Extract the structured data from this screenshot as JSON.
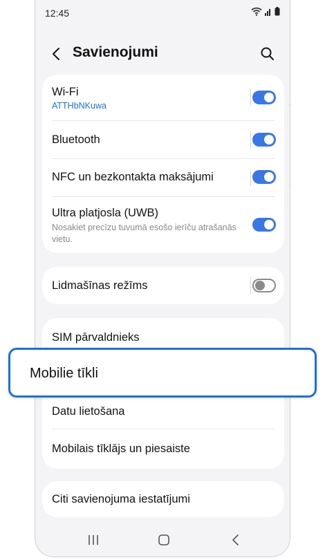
{
  "status_bar": {
    "time": "12:45"
  },
  "header": {
    "title": "Savienojumi"
  },
  "connections": [
    {
      "label": "Wi-Fi",
      "sub": "ATTHbNKuwa",
      "on": true
    },
    {
      "label": "Bluetooth",
      "on": true
    },
    {
      "label": "NFC un bezkontakta maksājumi",
      "on": true
    },
    {
      "label": "Ultra platjosla (UWB)",
      "desc": "Nosakiet precīzu tuvumā esošo ierīču atrašanās vietu.",
      "on": true
    }
  ],
  "airplane": {
    "label": "Lidmašīnas režīms",
    "on": false
  },
  "sim_group": {
    "items": [
      {
        "label": "SIM pārvaldnieks"
      },
      {
        "label": "Mobilie tīkli"
      },
      {
        "label": "Datu lietošana"
      },
      {
        "label": "Mobilais tīklājs un piesaiste"
      }
    ]
  },
  "more": {
    "label": "Citi savienojuma iestatījumi"
  },
  "colors": {
    "accent": "#3a77e6",
    "highlight_border": "#1e6ee0",
    "link": "#1a73c8",
    "background": "#f4f4f6"
  },
  "icons": [
    "wifi-icon",
    "signal-icon",
    "battery-icon",
    "back-arrow-icon",
    "search-icon",
    "recents-icon",
    "home-icon",
    "nav-back-icon"
  ]
}
